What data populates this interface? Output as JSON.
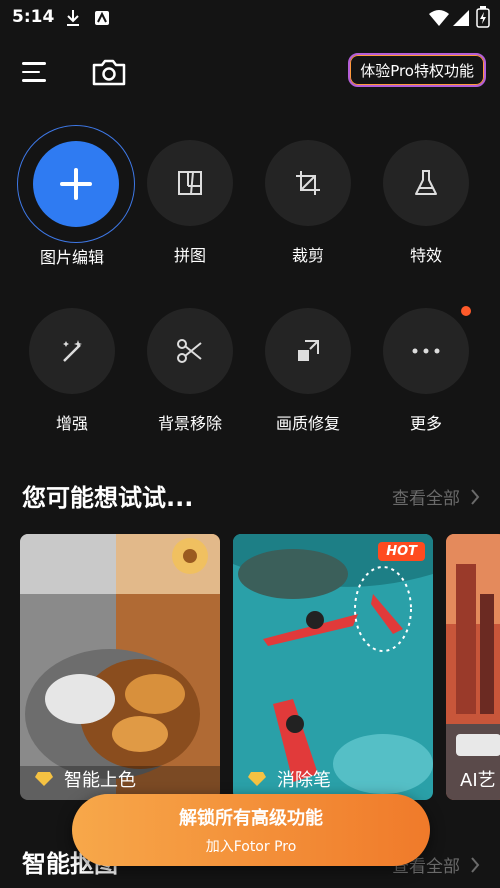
{
  "status": {
    "time": "5:14"
  },
  "header": {
    "pro_button": "体验Pro特权功能"
  },
  "tools_row1": [
    {
      "label": "图片编辑",
      "icon": "plus-icon"
    },
    {
      "label": "拼图",
      "icon": "collage-icon"
    },
    {
      "label": "裁剪",
      "icon": "crop-icon"
    },
    {
      "label": "特效",
      "icon": "flask-icon"
    }
  ],
  "tools_row2": [
    {
      "label": "增强",
      "icon": "magic-wand-icon"
    },
    {
      "label": "背景移除",
      "icon": "scissors-icon"
    },
    {
      "label": "画质修复",
      "icon": "upscale-icon"
    },
    {
      "label": "更多",
      "icon": "more-icon"
    }
  ],
  "suggest": {
    "title": "您可能想试试...",
    "see_all": "查看全部",
    "cards": [
      {
        "label": "智能上色",
        "badge": ""
      },
      {
        "label": "消除笔",
        "badge": "HOT"
      },
      {
        "label": "AI艺"
      }
    ]
  },
  "section2": {
    "title": "智能抠图",
    "see_all": "查看全部"
  },
  "unlock": {
    "title": "解锁所有高级功能",
    "subtitle": "加入Fotor Pro"
  },
  "colors": {
    "accent": "#2f7bf2",
    "unlock_start": "#f7a84a",
    "unlock_end": "#f07a2a",
    "hot": "#ff4b1f"
  }
}
